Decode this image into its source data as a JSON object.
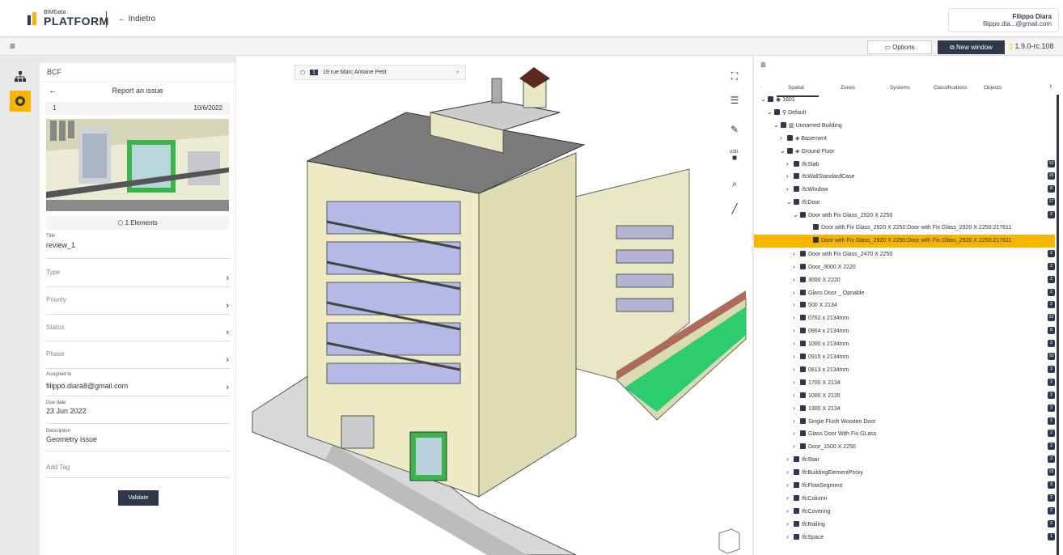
{
  "app": {
    "logo_small": "BIMData",
    "logo_big": "PLATFORM",
    "back_label": "← Indietro",
    "user_name": "Filippo Diara",
    "user_email": "filippo.dia...@gmail.com",
    "options_label": "Options",
    "new_window_label": "New window",
    "version": "1.9.0-rc.108",
    "accent_color": "#f9b400",
    "dark_color": "#2f374a"
  },
  "bcf": {
    "panel_title": "BCF",
    "report_title": "Report an issue",
    "index": "1",
    "date": "10/6/2022",
    "elements_label": "1 Elements",
    "title_label": "Title",
    "title_value": "review_1",
    "type_placeholder": "Type",
    "priority_placeholder": "Priority",
    "status_placeholder": "Status",
    "phase_placeholder": "Phase",
    "assigned_label": "Assigned to",
    "assigned_value": "filippo.diara8@gmail.com",
    "due_label": "Due date",
    "due_value": "23 Jun 2022",
    "desc_label": "Description",
    "desc_value": "Geometry issue",
    "tag_placeholder": "Add Tag",
    "validate_label": "Validate"
  },
  "viewer": {
    "model_index": "1",
    "model_name": "19 rue Marc Antoine Petit",
    "tools": [
      "fullscreen-icon",
      "settings-sliders-icon",
      "paint-icon",
      "orthographic-camera-icon",
      "search-icon",
      "measure-icon"
    ],
    "ortho_label": "orth."
  },
  "spatial": {
    "tabs": [
      "Spatial",
      "Zones",
      "Systems",
      "Classifications",
      "Objects"
    ],
    "active_tab": "Spatial",
    "rows": [
      {
        "label": "1601",
        "count": ""
      },
      {
        "label": "Default",
        "count": ""
      },
      {
        "label": "Unnamed Building",
        "count": ""
      },
      {
        "label": "Basement",
        "count": ""
      },
      {
        "label": "Ground Floor",
        "count": ""
      },
      {
        "label": "IfcSlab",
        "count": "12"
      },
      {
        "label": "IfcWallStandardCase",
        "count": "15"
      },
      {
        "label": "IfcWindow",
        "count": "8"
      },
      {
        "label": "IfcDoor",
        "count": "17"
      },
      {
        "label": "Door with Fix Glass_2920 X 2250",
        "count": "2"
      },
      {
        "label": "Door with Fix Glass_2920 X 2250:Door with Fix Glass_2920 X 2250:217611",
        "count": ""
      },
      {
        "label": "Door with Fix Glass_2920 X 2250:Door with Fix Glass_2920 X 2250:217611",
        "count": ""
      },
      {
        "label": "Door with Fix Glass_2470 X 2250",
        "count": "2"
      },
      {
        "label": "Door_3000 X 2220",
        "count": "2"
      },
      {
        "label": "3000 X 2220",
        "count": "2"
      },
      {
        "label": "Glass Door _ Opnable",
        "count": "2"
      },
      {
        "label": "500 X 2134",
        "count": "2"
      },
      {
        "label": "0762 x 2134mm",
        "count": "22"
      },
      {
        "label": "0864 x 2134mm",
        "count": "8"
      },
      {
        "label": "1000 x 2134mm",
        "count": "2"
      },
      {
        "label": "0915 x 2134mm",
        "count": "10"
      },
      {
        "label": "0813 x 2134mm",
        "count": "2"
      },
      {
        "label": "1700 X 2134",
        "count": "2"
      },
      {
        "label": "1000 X 2135",
        "count": "2"
      },
      {
        "label": "1300 X 2134",
        "count": "2"
      },
      {
        "label": "Single Flush Wooden Door",
        "count": "2"
      },
      {
        "label": "Glass Door With Fix GLass",
        "count": "2"
      },
      {
        "label": "Door_1500 X 2250",
        "count": "2"
      },
      {
        "label": "IfcStair",
        "count": "2"
      },
      {
        "label": "IfcBuildingElementProxy",
        "count": "15"
      },
      {
        "label": "IfcFlowSegment",
        "count": "3"
      },
      {
        "label": "IfcColumn",
        "count": "2"
      },
      {
        "label": "IfcCovering",
        "count": "2"
      },
      {
        "label": "IfcRailing",
        "count": "2"
      },
      {
        "label": "IfcSpace",
        "count": "1"
      }
    ]
  }
}
